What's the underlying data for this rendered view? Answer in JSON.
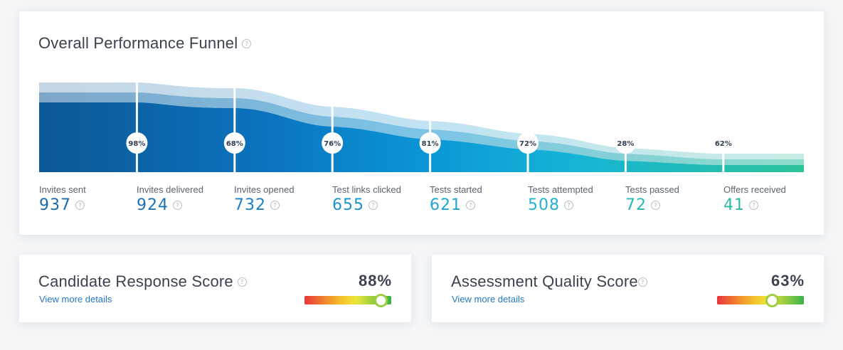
{
  "funnel": {
    "title": "Overall Performance Funnel",
    "help_glyph": "?",
    "stages": [
      {
        "label": "Invites sent",
        "value": "937",
        "color": "#1c6aa8"
      },
      {
        "label": "Invites delivered",
        "value": "924",
        "color": "#1b72b4",
        "conversion": "98%"
      },
      {
        "label": "Invites opened",
        "value": "732",
        "color": "#1a82c4",
        "conversion": "68%"
      },
      {
        "label": "Test links clicked",
        "value": "655",
        "color": "#1b92cc",
        "conversion": "76%"
      },
      {
        "label": "Tests started",
        "value": "621",
        "color": "#1fa6d1",
        "conversion": "81%"
      },
      {
        "label": "Tests attempted",
        "value": "508",
        "color": "#22b3cc",
        "conversion": "72%"
      },
      {
        "label": "Tests passed",
        "value": "72",
        "color": "#26b8b8",
        "conversion": "28%"
      },
      {
        "label": "Offers received",
        "value": "41",
        "color": "#2ab9a2",
        "conversion": "62%"
      }
    ]
  },
  "candidate_score": {
    "title": "Candidate Response Score",
    "link": "View more details",
    "score": "88%",
    "gauge_fraction": 0.88
  },
  "assessment_score": {
    "title": "Assessment Quality Score",
    "link": "View more details",
    "score": "63%",
    "gauge_fraction": 0.63
  }
}
